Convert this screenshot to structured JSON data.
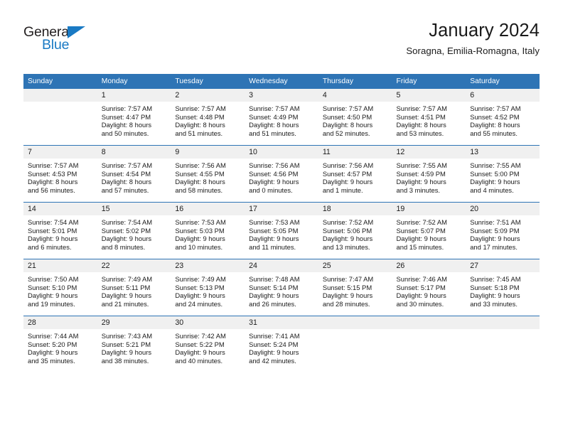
{
  "logo": {
    "word_one": "General",
    "word_two": "Blue",
    "triangle_color": "#1a7ac4"
  },
  "header": {
    "month_title": "January 2024",
    "location": "Soragna, Emilia-Romagna, Italy"
  },
  "theme": {
    "header_blue": "#2e74b5",
    "daynum_gray": "#f0f0f0",
    "text": "#1a1a1a"
  },
  "calendar": {
    "weekday_headers": [
      "Sunday",
      "Monday",
      "Tuesday",
      "Wednesday",
      "Thursday",
      "Friday",
      "Saturday"
    ],
    "weeks": [
      [
        {
          "day": "",
          "lines": []
        },
        {
          "day": "1",
          "lines": [
            "Sunrise: 7:57 AM",
            "Sunset: 4:47 PM",
            "Daylight: 8 hours",
            "and 50 minutes."
          ]
        },
        {
          "day": "2",
          "lines": [
            "Sunrise: 7:57 AM",
            "Sunset: 4:48 PM",
            "Daylight: 8 hours",
            "and 51 minutes."
          ]
        },
        {
          "day": "3",
          "lines": [
            "Sunrise: 7:57 AM",
            "Sunset: 4:49 PM",
            "Daylight: 8 hours",
            "and 51 minutes."
          ]
        },
        {
          "day": "4",
          "lines": [
            "Sunrise: 7:57 AM",
            "Sunset: 4:50 PM",
            "Daylight: 8 hours",
            "and 52 minutes."
          ]
        },
        {
          "day": "5",
          "lines": [
            "Sunrise: 7:57 AM",
            "Sunset: 4:51 PM",
            "Daylight: 8 hours",
            "and 53 minutes."
          ]
        },
        {
          "day": "6",
          "lines": [
            "Sunrise: 7:57 AM",
            "Sunset: 4:52 PM",
            "Daylight: 8 hours",
            "and 55 minutes."
          ]
        }
      ],
      [
        {
          "day": "7",
          "lines": [
            "Sunrise: 7:57 AM",
            "Sunset: 4:53 PM",
            "Daylight: 8 hours",
            "and 56 minutes."
          ]
        },
        {
          "day": "8",
          "lines": [
            "Sunrise: 7:57 AM",
            "Sunset: 4:54 PM",
            "Daylight: 8 hours",
            "and 57 minutes."
          ]
        },
        {
          "day": "9",
          "lines": [
            "Sunrise: 7:56 AM",
            "Sunset: 4:55 PM",
            "Daylight: 8 hours",
            "and 58 minutes."
          ]
        },
        {
          "day": "10",
          "lines": [
            "Sunrise: 7:56 AM",
            "Sunset: 4:56 PM",
            "Daylight: 9 hours",
            "and 0 minutes."
          ]
        },
        {
          "day": "11",
          "lines": [
            "Sunrise: 7:56 AM",
            "Sunset: 4:57 PM",
            "Daylight: 9 hours",
            "and 1 minute."
          ]
        },
        {
          "day": "12",
          "lines": [
            "Sunrise: 7:55 AM",
            "Sunset: 4:59 PM",
            "Daylight: 9 hours",
            "and 3 minutes."
          ]
        },
        {
          "day": "13",
          "lines": [
            "Sunrise: 7:55 AM",
            "Sunset: 5:00 PM",
            "Daylight: 9 hours",
            "and 4 minutes."
          ]
        }
      ],
      [
        {
          "day": "14",
          "lines": [
            "Sunrise: 7:54 AM",
            "Sunset: 5:01 PM",
            "Daylight: 9 hours",
            "and 6 minutes."
          ]
        },
        {
          "day": "15",
          "lines": [
            "Sunrise: 7:54 AM",
            "Sunset: 5:02 PM",
            "Daylight: 9 hours",
            "and 8 minutes."
          ]
        },
        {
          "day": "16",
          "lines": [
            "Sunrise: 7:53 AM",
            "Sunset: 5:03 PM",
            "Daylight: 9 hours",
            "and 10 minutes."
          ]
        },
        {
          "day": "17",
          "lines": [
            "Sunrise: 7:53 AM",
            "Sunset: 5:05 PM",
            "Daylight: 9 hours",
            "and 11 minutes."
          ]
        },
        {
          "day": "18",
          "lines": [
            "Sunrise: 7:52 AM",
            "Sunset: 5:06 PM",
            "Daylight: 9 hours",
            "and 13 minutes."
          ]
        },
        {
          "day": "19",
          "lines": [
            "Sunrise: 7:52 AM",
            "Sunset: 5:07 PM",
            "Daylight: 9 hours",
            "and 15 minutes."
          ]
        },
        {
          "day": "20",
          "lines": [
            "Sunrise: 7:51 AM",
            "Sunset: 5:09 PM",
            "Daylight: 9 hours",
            "and 17 minutes."
          ]
        }
      ],
      [
        {
          "day": "21",
          "lines": [
            "Sunrise: 7:50 AM",
            "Sunset: 5:10 PM",
            "Daylight: 9 hours",
            "and 19 minutes."
          ]
        },
        {
          "day": "22",
          "lines": [
            "Sunrise: 7:49 AM",
            "Sunset: 5:11 PM",
            "Daylight: 9 hours",
            "and 21 minutes."
          ]
        },
        {
          "day": "23",
          "lines": [
            "Sunrise: 7:49 AM",
            "Sunset: 5:13 PM",
            "Daylight: 9 hours",
            "and 24 minutes."
          ]
        },
        {
          "day": "24",
          "lines": [
            "Sunrise: 7:48 AM",
            "Sunset: 5:14 PM",
            "Daylight: 9 hours",
            "and 26 minutes."
          ]
        },
        {
          "day": "25",
          "lines": [
            "Sunrise: 7:47 AM",
            "Sunset: 5:15 PM",
            "Daylight: 9 hours",
            "and 28 minutes."
          ]
        },
        {
          "day": "26",
          "lines": [
            "Sunrise: 7:46 AM",
            "Sunset: 5:17 PM",
            "Daylight: 9 hours",
            "and 30 minutes."
          ]
        },
        {
          "day": "27",
          "lines": [
            "Sunrise: 7:45 AM",
            "Sunset: 5:18 PM",
            "Daylight: 9 hours",
            "and 33 minutes."
          ]
        }
      ],
      [
        {
          "day": "28",
          "lines": [
            "Sunrise: 7:44 AM",
            "Sunset: 5:20 PM",
            "Daylight: 9 hours",
            "and 35 minutes."
          ]
        },
        {
          "day": "29",
          "lines": [
            "Sunrise: 7:43 AM",
            "Sunset: 5:21 PM",
            "Daylight: 9 hours",
            "and 38 minutes."
          ]
        },
        {
          "day": "30",
          "lines": [
            "Sunrise: 7:42 AM",
            "Sunset: 5:22 PM",
            "Daylight: 9 hours",
            "and 40 minutes."
          ]
        },
        {
          "day": "31",
          "lines": [
            "Sunrise: 7:41 AM",
            "Sunset: 5:24 PM",
            "Daylight: 9 hours",
            "and 42 minutes."
          ]
        },
        {
          "day": "",
          "lines": []
        },
        {
          "day": "",
          "lines": []
        },
        {
          "day": "",
          "lines": []
        }
      ]
    ]
  }
}
